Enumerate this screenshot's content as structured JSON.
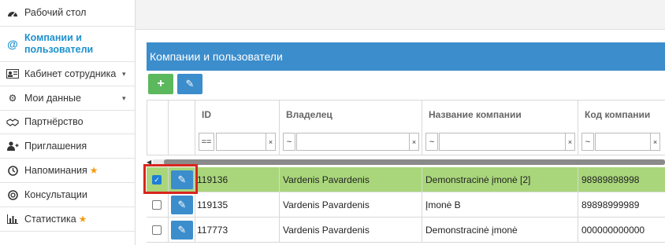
{
  "sidebar": {
    "items": [
      {
        "label": "Рабочий стол",
        "icon": "dashboard-icon"
      },
      {
        "label": "Компании и пользователи",
        "icon": "at-icon",
        "active": true
      },
      {
        "label": "Кабинет сотрудника",
        "icon": "id-card-icon",
        "has_chevron": true
      },
      {
        "label": "Мои данные",
        "icon": "gears-icon",
        "has_chevron": true
      },
      {
        "label": "Партнёрство",
        "icon": "handshake-icon"
      },
      {
        "label": "Приглашения",
        "icon": "user-plus-icon"
      },
      {
        "label": "Напоминания",
        "icon": "clock-icon",
        "star": true
      },
      {
        "label": "Консультации",
        "icon": "life-ring-icon"
      },
      {
        "label": "Статистика",
        "icon": "bar-chart-icon",
        "star": true
      }
    ]
  },
  "panel": {
    "title": "Компании и пользователи"
  },
  "toolbar": {
    "add_glyph": "+",
    "edit_glyph": "✎"
  },
  "grid": {
    "columns": [
      "ID",
      "Владелец",
      "Название компании",
      "Код компании"
    ],
    "filters": {
      "id_op": "==",
      "owner_op": "~",
      "name_op": "~",
      "code_op": "~",
      "clear": "×"
    },
    "rows": [
      {
        "checked": true,
        "id": "119136",
        "owner": "Vardenis Pavardenis",
        "company": "Demonstracinė įmonė [2]",
        "code": "98989898998"
      },
      {
        "checked": false,
        "id": "119135",
        "owner": "Vardenis Pavardenis",
        "company": "Įmonė B",
        "code": "89898999989"
      },
      {
        "checked": false,
        "id": "117773",
        "owner": "Vardenis Pavardenis",
        "company": "Demonstracinė įmonė",
        "code": "000000000000"
      }
    ]
  },
  "colors": {
    "accent": "#3c8dcc",
    "add_button": "#5cb85c",
    "selected_row": "#a9d67b",
    "highlight_box": "#d9251d",
    "active_link": "#1e91cf",
    "star": "#f39c12"
  }
}
